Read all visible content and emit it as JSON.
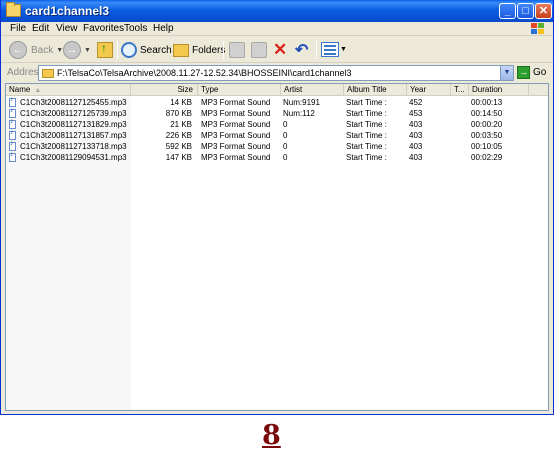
{
  "window": {
    "title": "card1channel3"
  },
  "menu": [
    "File",
    "Edit",
    "View",
    "Favorites",
    "Tools",
    "Help"
  ],
  "toolbar": {
    "back_label": "Back",
    "search_label": "Search",
    "folders_label": "Folders"
  },
  "address": {
    "label": "Address",
    "path": "F:\\TelsaCo\\TelsaArchive\\2008.11.27-12.52.34\\BHOSSEINI\\card1channel3",
    "go_label": "Go"
  },
  "columns": {
    "name": "Name",
    "size": "Size",
    "type": "Type",
    "artist": "Artist",
    "album": "Album Title",
    "year": "Year",
    "track": "T...",
    "duration": "Duration"
  },
  "files": [
    {
      "name": "C1Ch3t20081127125455.mp3",
      "size": "14 KB",
      "type": "MP3 Format Sound",
      "artist": "Num:9191",
      "album": "Start Time :",
      "year": "452",
      "duration": "00:00:13"
    },
    {
      "name": "C1Ch3t20081127125739.mp3",
      "size": "870 KB",
      "type": "MP3 Format Sound",
      "artist": "Num:112",
      "album": "Start Time :",
      "year": "453",
      "duration": "00:14:50"
    },
    {
      "name": "C1Ch3t20081127131829.mp3",
      "size": "21 KB",
      "type": "MP3 Format Sound",
      "artist": "0",
      "album": "Start Time :",
      "year": "403",
      "duration": "00:00:20"
    },
    {
      "name": "C1Ch3t20081127131857.mp3",
      "size": "226 KB",
      "type": "MP3 Format Sound",
      "artist": "0",
      "album": "Start Time :",
      "year": "403",
      "duration": "00:03:50"
    },
    {
      "name": "C1Ch3t20081127133718.mp3",
      "size": "592 KB",
      "type": "MP3 Format Sound",
      "artist": "0",
      "album": "Start Time :",
      "year": "403",
      "duration": "00:10:05"
    },
    {
      "name": "C1Ch3t20081129094531.mp3",
      "size": "147 KB",
      "type": "MP3 Format Sound",
      "artist": "0",
      "album": "Start Time :",
      "year": "403",
      "duration": "00:02:29"
    }
  ],
  "page_number": "8"
}
